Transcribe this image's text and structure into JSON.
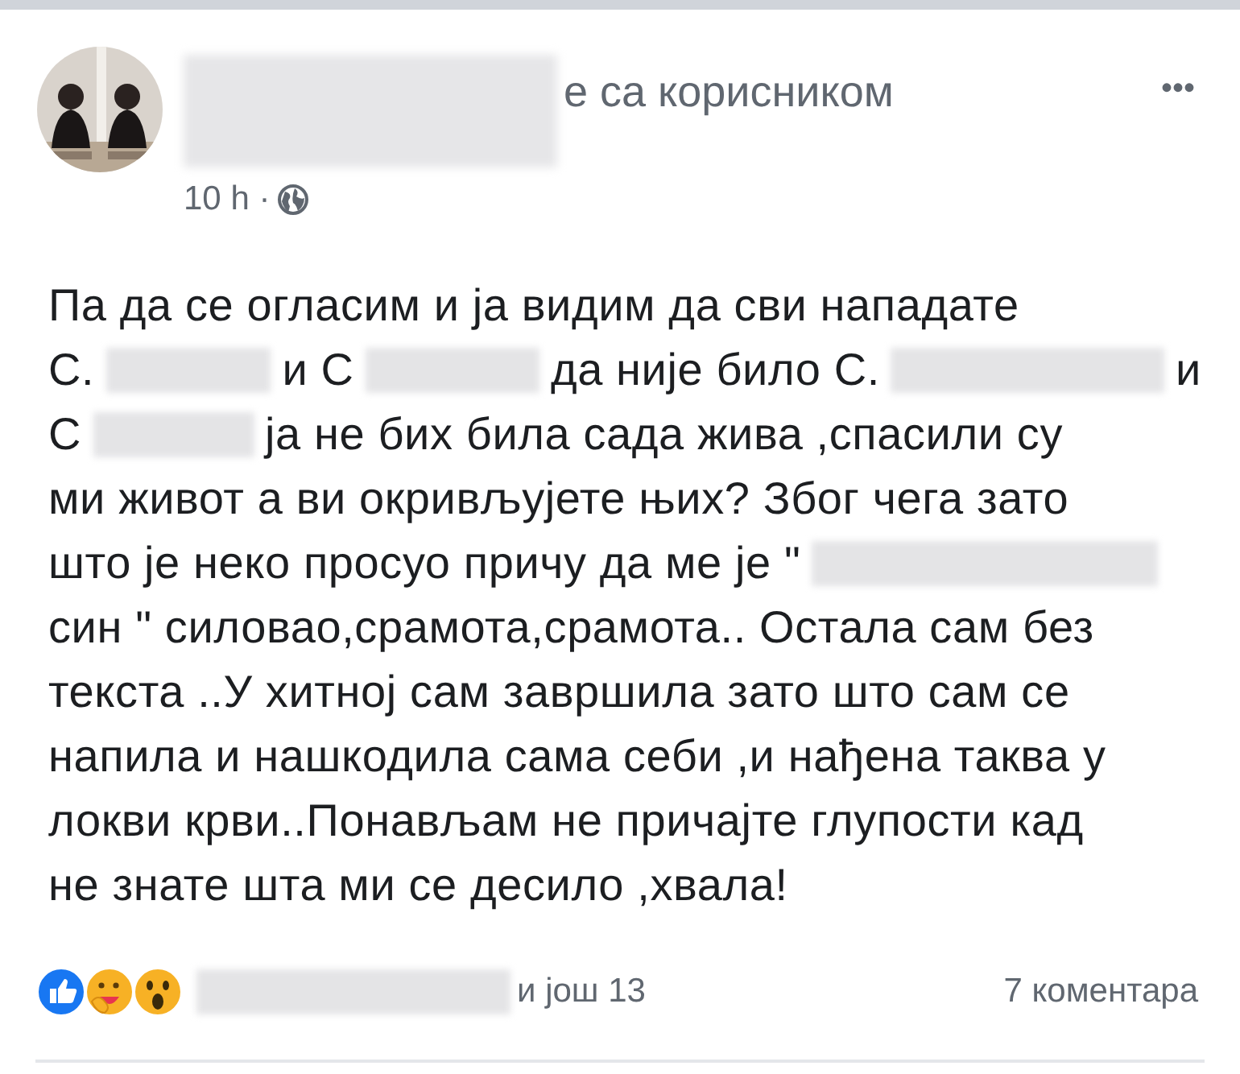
{
  "post": {
    "avatar": {
      "kind": "picture"
    },
    "author_suffix": "е са корисником",
    "time": "10 h ·",
    "more": "•••",
    "body": [
      [
        {
          "kind": "text",
          "text": "Па да се огласим и ја видим да сви нападате"
        }
      ],
      [
        {
          "kind": "text",
          "text": "С."
        },
        {
          "kind": "blur"
        },
        {
          "kind": "text",
          "text": "и С"
        },
        {
          "kind": "blur"
        },
        {
          "kind": "text",
          "text": "да није било С."
        },
        {
          "kind": "blur"
        },
        {
          "kind": "text",
          "text": "и"
        }
      ],
      [
        {
          "kind": "text",
          "text": "С"
        },
        {
          "kind": "blur"
        },
        {
          "kind": "text",
          "text": "ја не бих била сада жива ,спасили су"
        }
      ],
      [
        {
          "kind": "text",
          "text": "ми живот а ви окривљујете њих? Због чега зато"
        }
      ],
      [
        {
          "kind": "text",
          "text": "што је неко просуо причу да ме је \""
        },
        {
          "kind": "blur"
        }
      ],
      [
        {
          "kind": "text",
          "text": "син \" силовао,срамота,срамота.. Остала сам без"
        }
      ],
      [
        {
          "kind": "text",
          "text": "текста ..У хитној сам завршила зато што сам се"
        }
      ],
      [
        {
          "kind": "text",
          "text": "напила и нашкодила сама себи ,и нађена таква у"
        }
      ],
      [
        {
          "kind": "text",
          "text": "локви крви..Понављам не причајте глупости кад"
        }
      ],
      [
        {
          "kind": "text",
          "text": "не знате шта ми се десило ,хвала!"
        }
      ]
    ],
    "reactions": [
      {
        "kind": "like"
      },
      {
        "kind": "care"
      },
      {
        "kind": "wow"
      }
    ],
    "reaction_text": "и још 13",
    "comments": "7 коментара"
  }
}
